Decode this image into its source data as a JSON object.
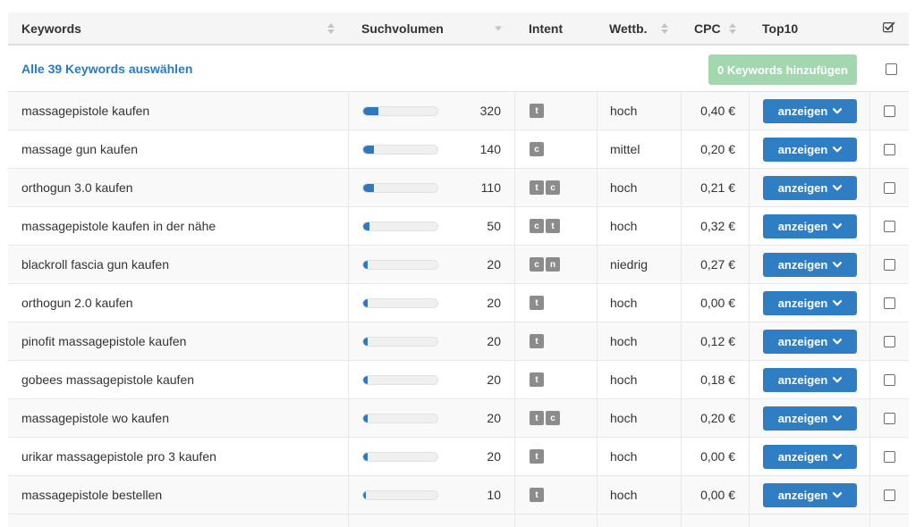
{
  "header": {
    "keywords": "Keywords",
    "volume": "Suchvolumen",
    "intent": "Intent",
    "competition": "Wettb.",
    "cpc": "CPC",
    "top10": "Top10"
  },
  "select_all": {
    "link_label": "Alle 39 Keywords auswählen",
    "add_button_label": "0 Keywords hinzufügen"
  },
  "top10_button_label": "anzeigen",
  "colors": {
    "accent_blue": "#2f7ec4",
    "link_blue": "#2a7bbd",
    "add_button_green": "#a3d7b0",
    "badge_gray": "#8c8c8c"
  },
  "rows": [
    {
      "keyword": "massagepistole kaufen",
      "volume": "320",
      "volume_fill": 0.2,
      "intent": [
        "t"
      ],
      "competition": "hoch",
      "cpc": "0,40 €"
    },
    {
      "keyword": "massage gun kaufen",
      "volume": "140",
      "volume_fill": 0.15,
      "intent": [
        "c"
      ],
      "competition": "mittel",
      "cpc": "0,20 €"
    },
    {
      "keyword": "orthogun 3.0 kaufen",
      "volume": "110",
      "volume_fill": 0.15,
      "intent": [
        "t",
        "c"
      ],
      "competition": "hoch",
      "cpc": "0,21 €"
    },
    {
      "keyword": "massagepistole kaufen in der nähe",
      "volume": "50",
      "volume_fill": 0.08,
      "intent": [
        "c",
        "t"
      ],
      "competition": "hoch",
      "cpc": "0,32 €"
    },
    {
      "keyword": "blackroll fascia gun kaufen",
      "volume": "20",
      "volume_fill": 0.06,
      "intent": [
        "c",
        "n"
      ],
      "competition": "niedrig",
      "cpc": "0,27 €"
    },
    {
      "keyword": "orthogun 2.0 kaufen",
      "volume": "20",
      "volume_fill": 0.06,
      "intent": [
        "t"
      ],
      "competition": "hoch",
      "cpc": "0,00 €"
    },
    {
      "keyword": "pinofit massagepistole kaufen",
      "volume": "20",
      "volume_fill": 0.06,
      "intent": [
        "t"
      ],
      "competition": "hoch",
      "cpc": "0,12 €"
    },
    {
      "keyword": "gobees massagepistole kaufen",
      "volume": "20",
      "volume_fill": 0.06,
      "intent": [
        "t"
      ],
      "competition": "hoch",
      "cpc": "0,18 €"
    },
    {
      "keyword": "massagepistole wo kaufen",
      "volume": "20",
      "volume_fill": 0.06,
      "intent": [
        "t",
        "c"
      ],
      "competition": "hoch",
      "cpc": "0,20 €"
    },
    {
      "keyword": "urikar massagepistole pro 3 kaufen",
      "volume": "20",
      "volume_fill": 0.06,
      "intent": [
        "t"
      ],
      "competition": "hoch",
      "cpc": "0,00 €"
    },
    {
      "keyword": "massagepistole bestellen",
      "volume": "10",
      "volume_fill": 0.04,
      "intent": [
        "t"
      ],
      "competition": "hoch",
      "cpc": "0,00 €"
    }
  ]
}
